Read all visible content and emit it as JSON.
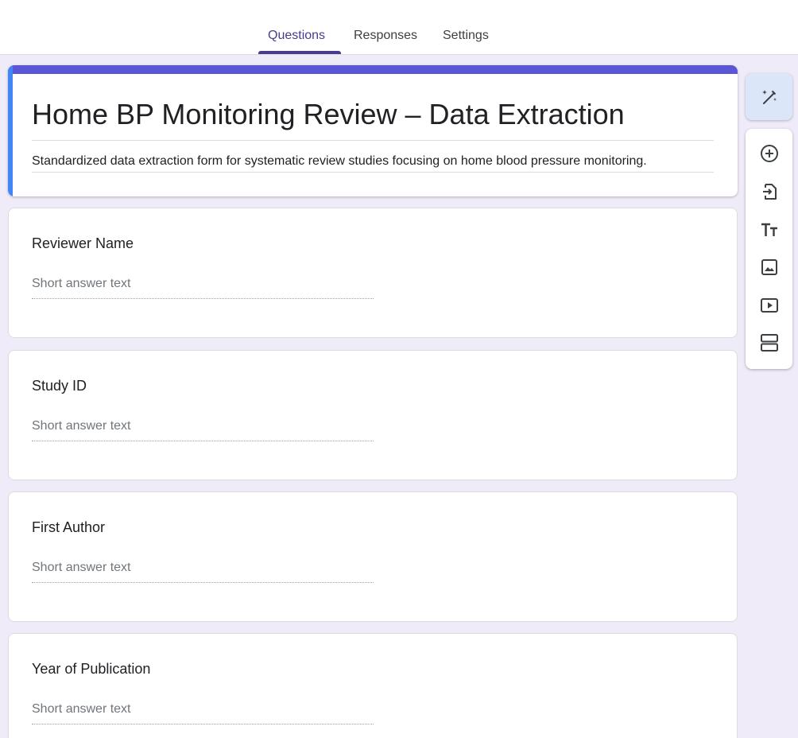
{
  "tabs": [
    {
      "label": "Questions",
      "active": true
    },
    {
      "label": "Responses",
      "active": false
    },
    {
      "label": "Settings",
      "active": false
    }
  ],
  "form": {
    "title": "Home BP Monitoring Review – Data Extraction",
    "description": "Standardized data extraction form for systematic review studies focusing on home blood pressure monitoring."
  },
  "questions": [
    {
      "title": "Reviewer Name",
      "placeholder": "Short answer text"
    },
    {
      "title": "Study ID",
      "placeholder": "Short answer text"
    },
    {
      "title": "First Author",
      "placeholder": "Short answer text"
    },
    {
      "title": "Year of Publication",
      "placeholder": "Short answer text"
    }
  ],
  "toolbar": {
    "icons": [
      "magic-wand-icon",
      "add-question-icon",
      "import-questions-icon",
      "add-title-icon",
      "add-image-icon",
      "add-video-icon",
      "add-section-icon"
    ]
  },
  "colors": {
    "accent": "#4c3a8c",
    "header_band": "#5b56d6",
    "focus_band": "#4285f4",
    "background": "#f0ebf8"
  }
}
